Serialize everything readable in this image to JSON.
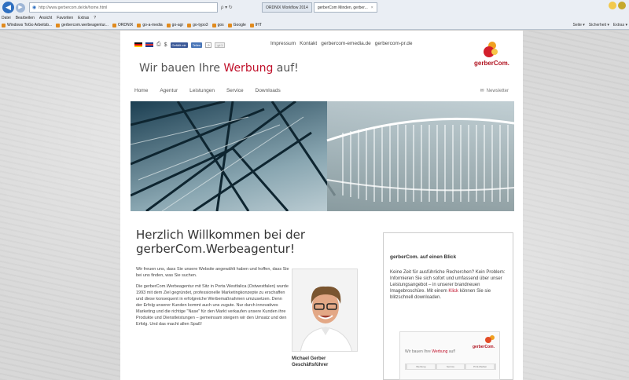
{
  "browser": {
    "address": "http://www.gerbercom.de/de/home.html",
    "address_controls": "ρ ▾ ↻",
    "tabs": [
      {
        "label": "ORDNIX Workflow 2014",
        "active": false
      },
      {
        "label": "gerberCom Minden, gerber...",
        "active": true
      }
    ],
    "menu": [
      "Datei",
      "Bearbeiten",
      "Ansicht",
      "Favoriten",
      "Extras",
      "?"
    ],
    "favorites": [
      "Windows ToGo Arbeitsb...",
      "gerbercom.werbeagentur...",
      "ORDNIX",
      "go-a-media",
      "go-agr",
      "go-typo3",
      "gos",
      "Google",
      "IHT"
    ],
    "toolbar_right": [
      "Seite ▾",
      "Sicherheit ▾",
      "Extras ▾"
    ]
  },
  "site": {
    "social": {
      "fb_like": "Gefällt mir",
      "share": "Teilen",
      "count": "0",
      "gplus": "g+1"
    },
    "top_links": [
      "Impressum",
      "Kontakt",
      "gerbercom-emedia.de",
      "gerbercom-pr.de"
    ],
    "brand": {
      "prefix": "Wir bauen Ihre ",
      "highlight": "Werbung",
      "suffix": " auf!"
    },
    "logo_text": "gerberCom.",
    "nav": [
      "Home",
      "Agentur",
      "Leistungen",
      "Service",
      "Downloads"
    ],
    "newsletter": "Newsletter",
    "heading": "Herzlich Willkommen bei der gerberCom.Werbeagentur!",
    "paragraphs": [
      "Wir freuen uns, dass Sie unsere Website angewählt haben und hoffen, dass Sie bei uns finden, was Sie suchen.",
      "Die gerberCom.Werbeagentur mit Sitz in Porta Westfalica (Ostwestfalen) wurde 1993 mit dem Ziel gegründet, professionelle Marketingkonzepte zu erschaffen und diese konsequent in erfolgreiche Werbemaßnahmen umzusetzen. Denn der Erfolg unserer Kunden kommt auch uns zugute. Nur durch innovatives Marketing und die richtige \"Nase\" für den Markt verkaufen unsere Kunden ihre Produkte und Dienstleistungen – gemeinsam steigern wir den Umsatz und den Erfolg. Und das macht allen Spaß!"
    ],
    "person": {
      "name": "Michael Gerber",
      "role": "Geschäftsführer"
    },
    "sidebox": {
      "title": "gerberCom. auf einen Blick",
      "text_before": "Keine Zeit für ausführliche Recherchen? Kein Problem: Informieren Sie sich sofort und umfassend über unser Leistungsangebot – in unserer brandneuen Imagebroschüre. Mit einem ",
      "link": "Klick",
      "text_after": " können Sie sie blitzschnell downloaden.",
      "brochure_title_prefix": "Wir bauen Ihre ",
      "brochure_title_highlight": "Werbung",
      "brochure_title_suffix": " auf!",
      "brochure_logo": "gerberCom.",
      "brochure_tabs": [
        "Werbung",
        "Service",
        "Print-Medien"
      ]
    }
  },
  "colors": {
    "accent": "#c0102a",
    "browser_blue": "#2f6fc0"
  }
}
